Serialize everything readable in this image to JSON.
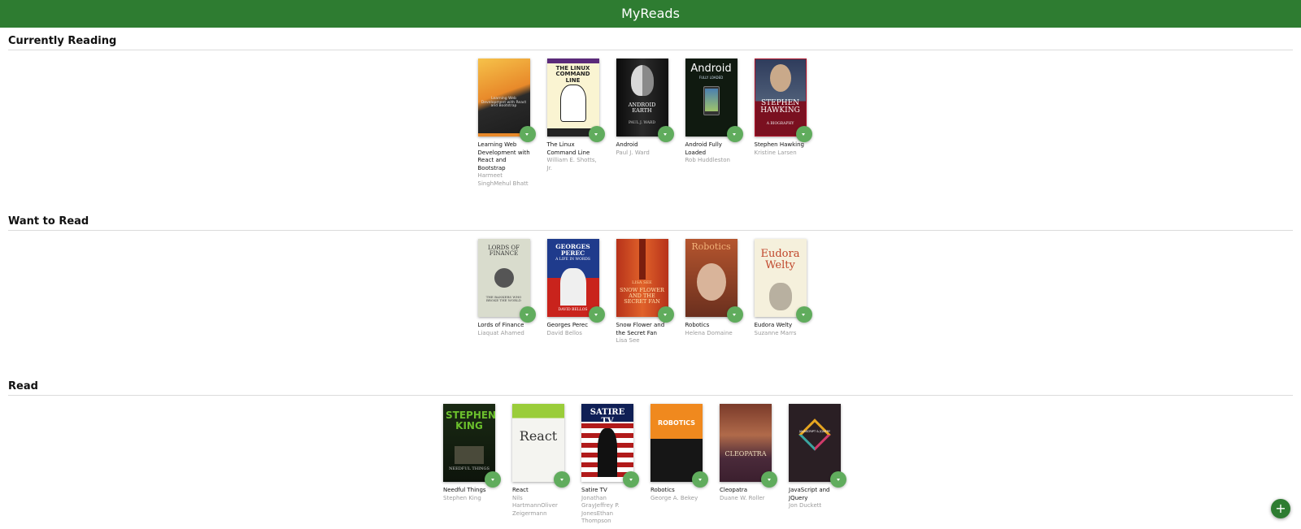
{
  "app": {
    "title": "MyReads"
  },
  "shelves": [
    {
      "title": "Currently Reading",
      "books": [
        {
          "title": "Learning Web Development with React and Bootstrap",
          "author": "Harmeet SinghMehul Bhatt",
          "cover_icon": "react-bootstrap-cover"
        },
        {
          "title": "The Linux Command Line",
          "author": "William E. Shotts, Jr.",
          "cover_icon": "linux-command-line-cover"
        },
        {
          "title": "Android",
          "author": "Paul J. Ward",
          "cover_icon": "android-earth-cover"
        },
        {
          "title": "Android Fully Loaded",
          "author": "Rob Huddleston",
          "cover_icon": "android-fully-loaded-cover"
        },
        {
          "title": "Stephen Hawking",
          "author": "Kristine Larsen",
          "cover_icon": "stephen-hawking-cover"
        }
      ]
    },
    {
      "title": "Want to Read",
      "books": [
        {
          "title": "Lords of Finance",
          "author": "Liaquat Ahamed",
          "cover_icon": "lords-of-finance-cover"
        },
        {
          "title": "Georges Perec",
          "author": "David Bellos",
          "cover_icon": "georges-perec-cover"
        },
        {
          "title": "Snow Flower and the Secret Fan",
          "author": "Lisa See",
          "cover_icon": "snow-flower-cover"
        },
        {
          "title": "Robotics",
          "author": "Helena Domaine",
          "cover_icon": "robotics-domaine-cover"
        },
        {
          "title": "Eudora Welty",
          "author": "Suzanne Marrs",
          "cover_icon": "eudora-welty-cover"
        }
      ]
    },
    {
      "title": "Read",
      "books": [
        {
          "title": "Needful Things",
          "author": "Stephen King",
          "cover_icon": "needful-things-cover"
        },
        {
          "title": "React",
          "author": "Nils HartmannOliver Zeigermann",
          "cover_icon": "react-cover"
        },
        {
          "title": "Satire TV",
          "author": "Jonathan GrayJeffrey P. JonesEthan Thompson",
          "cover_icon": "satire-tv-cover"
        },
        {
          "title": "Robotics",
          "author": "George A. Bekey",
          "cover_icon": "robotics-bekey-cover"
        },
        {
          "title": "Cleopatra",
          "author": "Duane W. Roller",
          "cover_icon": "cleopatra-cover"
        },
        {
          "title": "JavaScript and JQuery",
          "author": "Jon Duckett",
          "cover_icon": "javascript-jquery-cover"
        }
      ]
    }
  ],
  "cover_texts": {
    "rb": "Learning Web Development with React and Bootstrap",
    "linux": "THE LINUX COMMAND LINE",
    "android1": "ANDROID EARTH",
    "android1_author": "PAUL J. WARD",
    "android2": "Android",
    "android2_sub": "FULLY LOADED",
    "hawking": "STEPHEN HAWKING",
    "hawking_sub": "A BIOGRAPHY",
    "lords": "LORDS OF FINANCE",
    "lords_sub": "THE BANKERS WHO BROKE THE WORLD",
    "perec": "GEORGES PEREC",
    "perec_sub": "A LIFE IN WORDS",
    "perec_author": "DAVID BELLOS",
    "snow_author": "LISA SEE",
    "snow": "SNOW FLOWER AND THE SECRET FAN",
    "robotics1": "Robotics",
    "eudora": "Eudora Welty",
    "king": "STEPHEN KING",
    "needful": "NEEDFUL THINGS",
    "react": "React",
    "satire": "SATIRE TV",
    "robotics2": "ROBOTICS",
    "cleopatra": "CLEOPATRA",
    "js": "JAVASCRIPT & JQUERY"
  },
  "fab": {
    "label": "+"
  }
}
